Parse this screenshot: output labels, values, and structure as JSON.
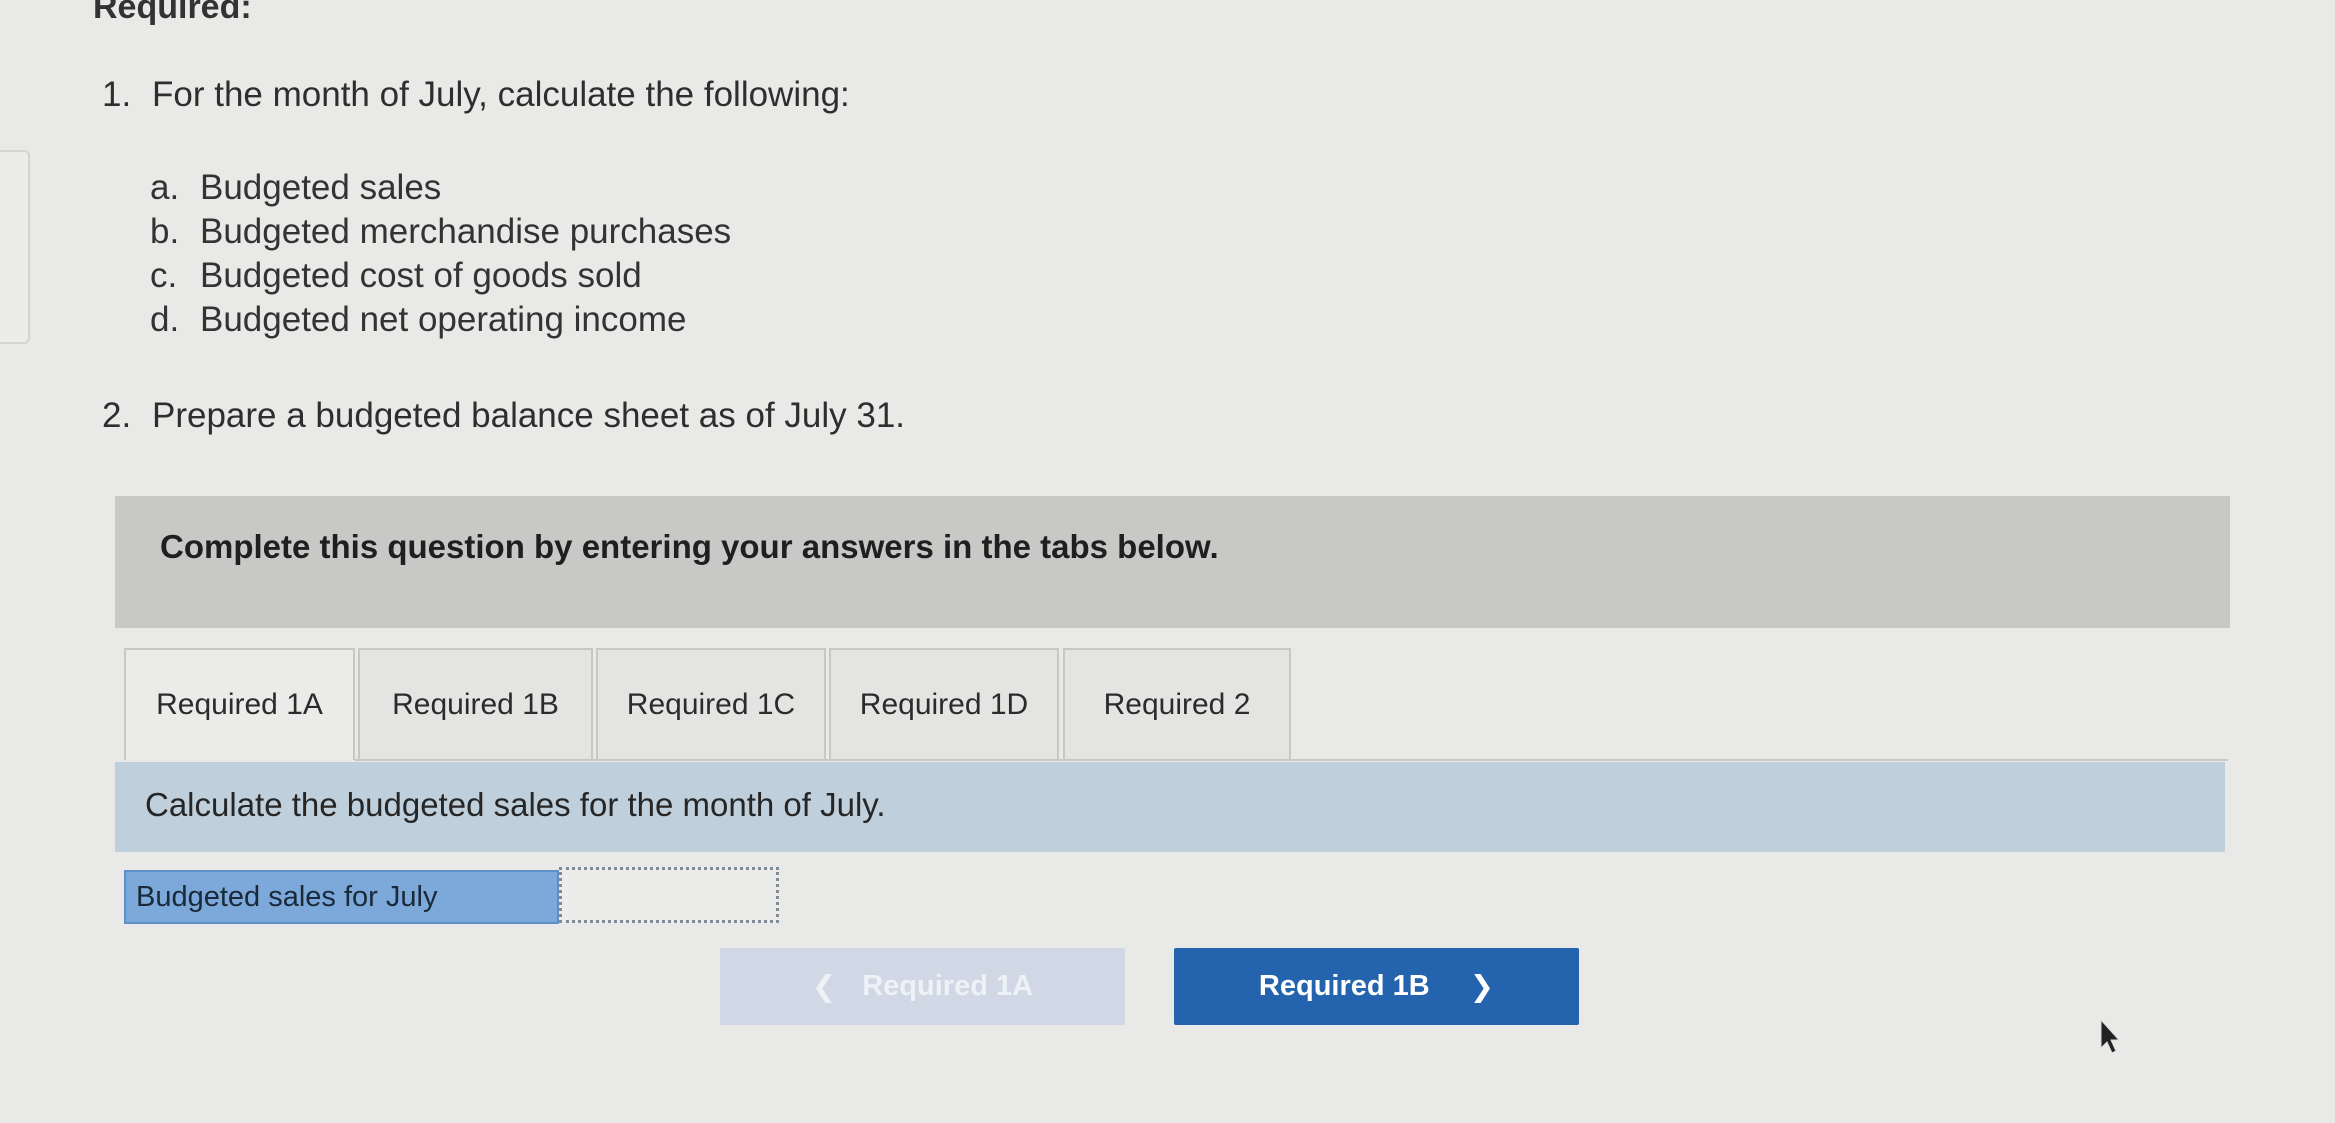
{
  "heading": "Required:",
  "instructions": {
    "item1": {
      "number": "1.",
      "text": "For the month of July, calculate the following:"
    },
    "subitems": [
      {
        "letter": "a.",
        "text": "Budgeted sales"
      },
      {
        "letter": "b.",
        "text": "Budgeted merchandise purchases"
      },
      {
        "letter": "c.",
        "text": "Budgeted cost of goods sold"
      },
      {
        "letter": "d.",
        "text": "Budgeted net operating income"
      }
    ],
    "item2": {
      "number": "2.",
      "text": "Prepare a budgeted balance sheet as of July 31."
    }
  },
  "banner": {
    "text": "Complete this question by entering your answers in the tabs below."
  },
  "tabs": [
    {
      "label": "Required 1A",
      "active": true
    },
    {
      "label": "Required 1B",
      "active": false
    },
    {
      "label": "Required 1C",
      "active": false
    },
    {
      "label": "Required 1D",
      "active": false
    },
    {
      "label": "Required 2",
      "active": false
    }
  ],
  "panel": {
    "instruction": "Calculate the budgeted sales for the month of July.",
    "answer_label": "Budgeted sales for July",
    "answer_value": ""
  },
  "navigation": {
    "prev_label": "Required 1A",
    "prev_icon": "chevron-left-icon",
    "next_label": "Required 1B",
    "next_icon": "chevron-right-icon",
    "prev_enabled": false,
    "next_color": "#2463ad"
  }
}
